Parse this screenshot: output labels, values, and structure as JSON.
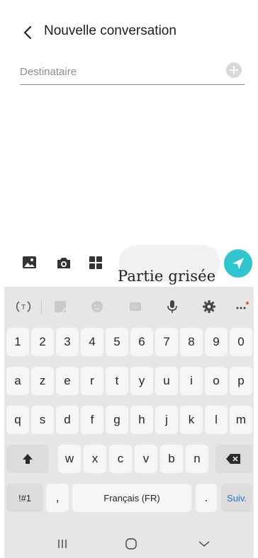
{
  "header": {
    "title": "Nouvelle conversation"
  },
  "recipient": {
    "placeholder": "Destinataire"
  },
  "composer": {
    "overlay_label": "Partie grisée"
  },
  "colors": {
    "send_accent": "#2ec5cf",
    "keyboard_bg": "#e6e6e6",
    "key_bg": "#f6f6f6"
  },
  "keyboard": {
    "row_numbers": [
      "1",
      "2",
      "3",
      "4",
      "5",
      "6",
      "7",
      "8",
      "9",
      "0"
    ],
    "row_1": [
      "a",
      "z",
      "e",
      "r",
      "t",
      "y",
      "u",
      "i",
      "o",
      "p"
    ],
    "row_2": [
      "q",
      "s",
      "d",
      "f",
      "g",
      "h",
      "j",
      "k",
      "l",
      "m"
    ],
    "row_3": [
      "w",
      "x",
      "c",
      "v",
      "b",
      "n"
    ],
    "symbols_key": "!#1",
    "comma_key": ",",
    "space_label": "Français (FR)",
    "period_key": ".",
    "next_key": "Suiv.",
    "toolbar_icons": [
      "translate-icon",
      "sticker-icon",
      "emoji-icon",
      "gif-icon",
      "microphone-icon",
      "settings-icon",
      "more-icon"
    ]
  },
  "nav": {
    "icons": [
      "recent-apps-icon",
      "home-icon",
      "back-chevron-icon"
    ]
  }
}
